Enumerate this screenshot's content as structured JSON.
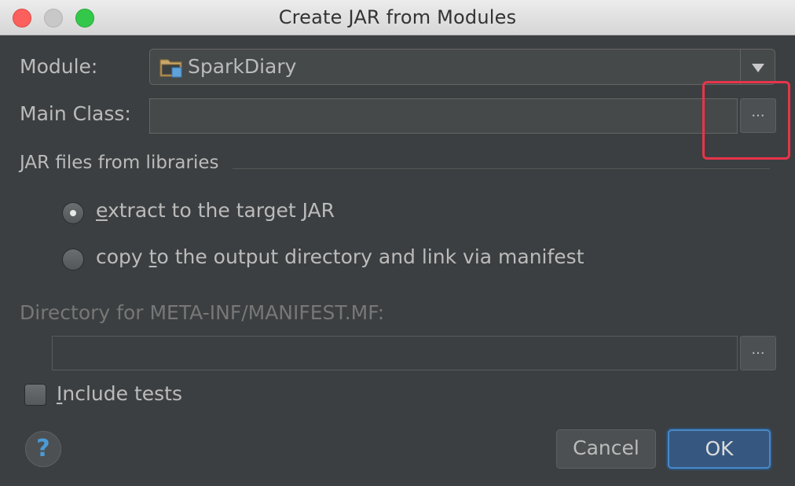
{
  "window": {
    "title": "Create JAR from Modules"
  },
  "form": {
    "module_label": "Module:",
    "module_value": "SparkDiary",
    "main_class_label": "Main Class:",
    "main_class_value": "",
    "browse_label": "...",
    "libraries_group_label": "JAR files from libraries",
    "options": [
      {
        "prefix": "",
        "mnemonic": "e",
        "suffix": "xtract to the target JAR",
        "selected": true
      },
      {
        "prefix": "copy ",
        "mnemonic": "t",
        "suffix": "o the output directory and link via manifest",
        "selected": false
      }
    ],
    "manifest_dir_label": "Directory for META-INF/MANIFEST.MF:",
    "manifest_dir_value": "",
    "include_tests_mnemonic": "I",
    "include_tests_rest": "nclude tests",
    "include_tests_checked": false
  },
  "footer": {
    "help_label": "?",
    "cancel_label": "Cancel",
    "ok_label": "OK"
  },
  "colors": {
    "dialog_bg": "#3c3f41",
    "highlight_annotation": "#e8344a",
    "default_button": "#365880",
    "help_icon": "#4b9bd6"
  }
}
